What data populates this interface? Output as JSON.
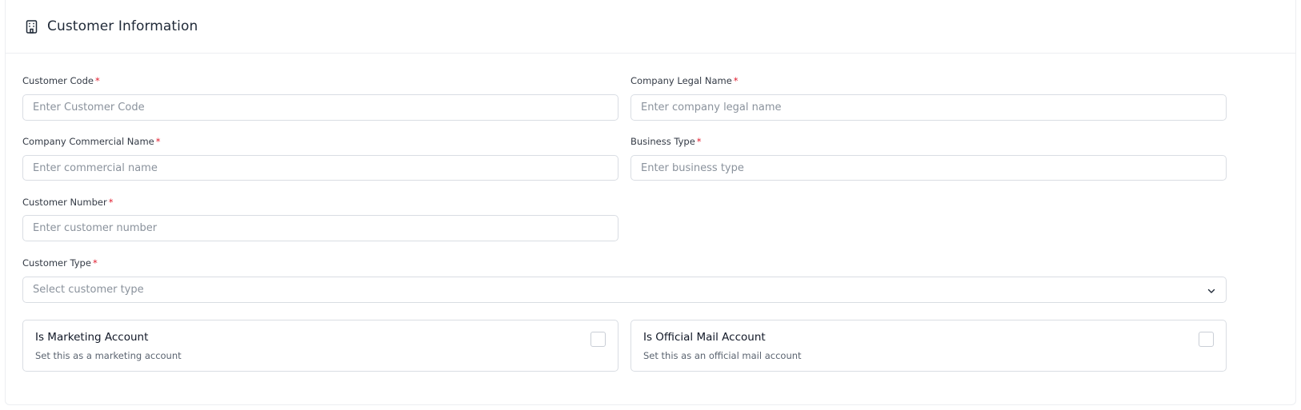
{
  "header": {
    "title": "Customer Information",
    "icon": "building-icon"
  },
  "fields": {
    "customer_code": {
      "label": "Customer Code",
      "required": "*",
      "placeholder": "Enter Customer Code",
      "value": ""
    },
    "company_legal_name": {
      "label": "Company Legal Name",
      "required": "*",
      "placeholder": "Enter company legal name",
      "value": ""
    },
    "company_commercial_name": {
      "label": "Company Commercial Name",
      "required": "*",
      "placeholder": "Enter commercial name",
      "value": ""
    },
    "business_type": {
      "label": "Business Type",
      "required": "*",
      "placeholder": "Enter business type",
      "value": ""
    },
    "customer_number": {
      "label": "Customer Number",
      "required": "*",
      "placeholder": "Enter customer number",
      "value": ""
    },
    "customer_type": {
      "label": "Customer Type",
      "required": "*",
      "placeholder": "Select customer type",
      "icon": "chevron-down-icon"
    }
  },
  "toggles": {
    "marketing": {
      "title": "Is Marketing Account",
      "description": "Set this as a marketing account",
      "checked": false
    },
    "official_mail": {
      "title": "Is Official Mail Account",
      "description": "Set this as an official mail account",
      "checked": false
    }
  },
  "colors": {
    "required": "#e11d2e",
    "border": "#d9dde3",
    "placeholder": "#8a929c"
  }
}
